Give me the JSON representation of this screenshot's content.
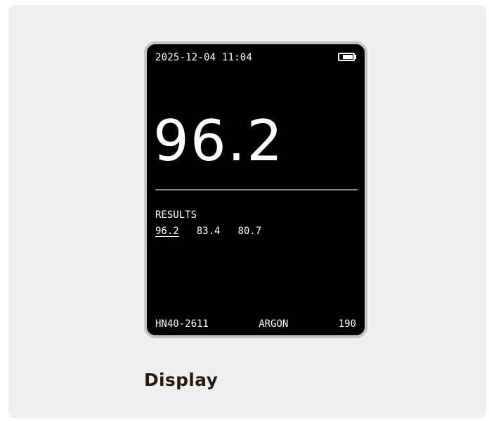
{
  "status": {
    "datetime": "2025-12-04 11:04",
    "battery_level": 0.75,
    "battery_icon": "battery-icon"
  },
  "reading": {
    "value": "96.2"
  },
  "results": {
    "label": "RESULTS",
    "values": [
      "96.2",
      "83.4",
      "80.7"
    ],
    "selected_index": 0
  },
  "footer": {
    "model": "HN40-2611",
    "gas": "ARGON",
    "count": "190"
  },
  "caption": "Display",
  "colors": {
    "card_background": "#efefef",
    "screen_background": "#000000",
    "bezel": "#c4c4c4",
    "caption_text": "#2b1a0e"
  }
}
